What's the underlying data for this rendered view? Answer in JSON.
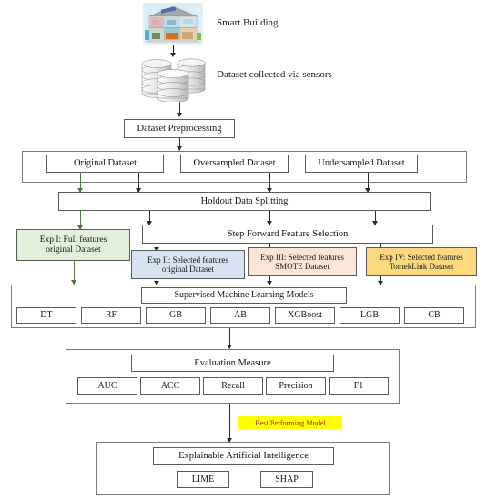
{
  "diagram": {
    "title": "Smart Building ML pipeline flowchart",
    "labels": {
      "smart_building": "Smart Building",
      "dataset_collected": "Dataset collected via sensors",
      "best_performing_model": "Best Performing Model"
    },
    "icons": {
      "house": "smart-building-cutaway-icon",
      "database": "database-stack-icon"
    },
    "nodes": {
      "preprocessing": "Dataset Preprocessing",
      "holdout": "Holdout Data Splitting",
      "feature_selection": "Step Forward Feature Selection",
      "ml_models": "Supervised Machine Learning Models",
      "evaluation": "Evaluation Measure",
      "xai": "Explainable Artificial Intelligence"
    },
    "datasets": [
      {
        "label": "Original Dataset"
      },
      {
        "label": "Oversampled Dataset"
      },
      {
        "label": "Undersampled Dataset"
      }
    ],
    "experiments": [
      {
        "line1": "Exp I: Full features",
        "line2": "original Dataset",
        "color": "#e2efda"
      },
      {
        "line1": "Exp II: Selected  features",
        "line2": "original Dataset",
        "color": "#d9e2f3"
      },
      {
        "line1": "Exp III: Selected  features",
        "line2": "SMOTE Dataset",
        "color": "#fbe5d6"
      },
      {
        "line1": "Exp IV: Selected  features",
        "line2": "TomekLink Dataset",
        "color": "#fcd97f"
      }
    ],
    "models": [
      "DT",
      "RF",
      "GB",
      "AB",
      "XGBoost",
      "LGB",
      "CB"
    ],
    "metrics": [
      "AUC",
      "ACC",
      "Recall",
      "Precision",
      "F1"
    ],
    "xai_methods": [
      "LIME",
      "SHAP"
    ],
    "colors": {
      "highlight_bg": "#ffff00",
      "highlight_text": "#8a1b1b",
      "connector": "#2b2b2b",
      "connector_green": "#4e7a3a",
      "box_border": "#5a5a5a"
    }
  }
}
